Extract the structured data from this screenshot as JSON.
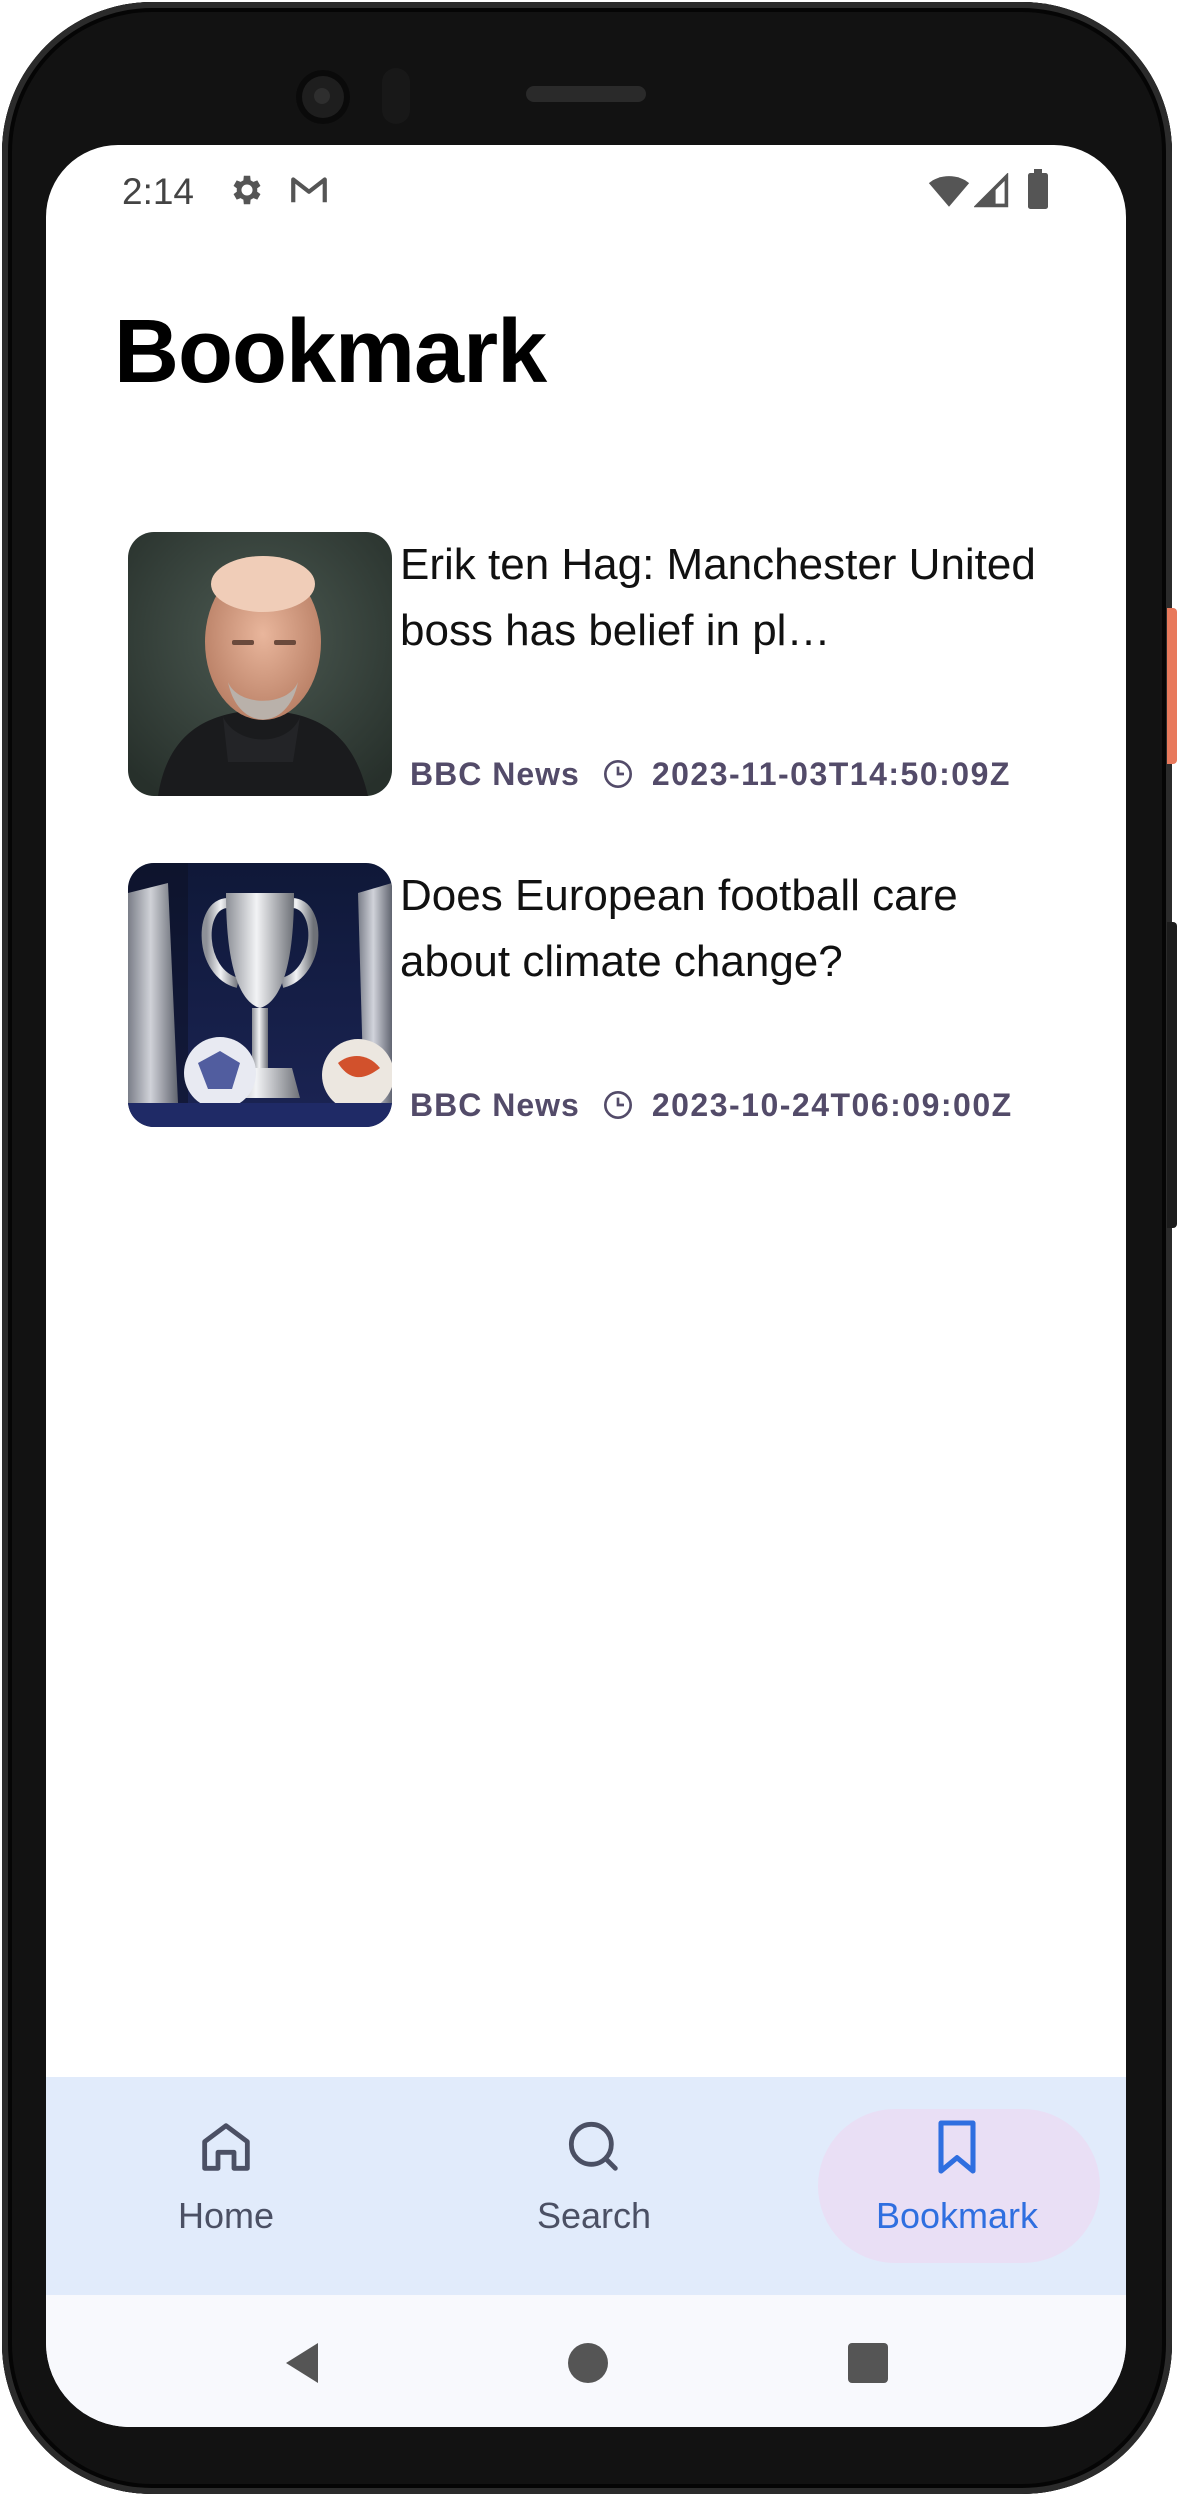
{
  "status_bar": {
    "time": "2:14"
  },
  "page": {
    "title": "Bookmark"
  },
  "articles": [
    {
      "title": "Erik ten Hag: Manchester United boss has belief in players…",
      "display_title": "Erik ten Hag: Manchester United boss has belief in pl…",
      "source": "BBC News",
      "published": "2023-11-03T14:50:09Z"
    },
    {
      "title": "Does European football care about climate change?",
      "display_title": "Does European football care about climate change?",
      "source": "BBC News",
      "published": "2023-10-24T06:09:00Z"
    }
  ],
  "bottom_nav": {
    "selected": "Bookmark",
    "items": [
      {
        "label": "Home",
        "icon": "home-icon"
      },
      {
        "label": "Search",
        "icon": "search-icon"
      },
      {
        "label": "Bookmark",
        "icon": "bookmark-icon"
      }
    ]
  },
  "colors": {
    "accent": "#2f6fe0",
    "nav_background": "#e1ebfb",
    "selected_pill": "#e9dff5",
    "meta_text": "#534b69"
  }
}
